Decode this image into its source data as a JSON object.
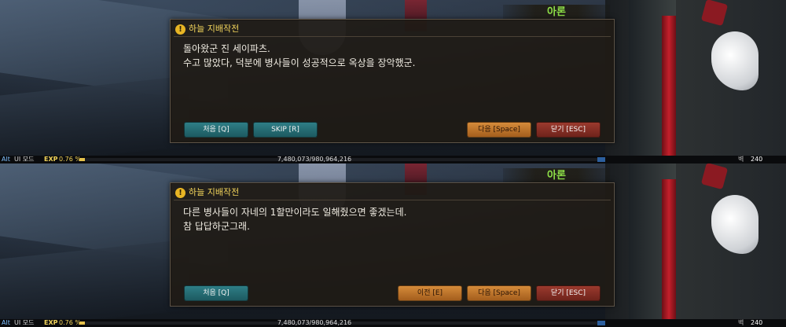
{
  "panels": [
    {
      "npc_name": "아론",
      "dialog": {
        "title": "하늘 지배작전",
        "lines": [
          "돌아왔군 진 세이파츠.",
          "수고 많았다, 덕분에 병사들이 성공적으로 옥상을 장악했군."
        ]
      },
      "buttons": {
        "first": "처음 [Q]",
        "skip": "SKIP [R]",
        "next": "다음 [Space]",
        "close": "닫기 [ESC]"
      }
    },
    {
      "npc_name": "아론",
      "dialog": {
        "title": "하늘 지배작전",
        "lines": [
          "다른 병사들이 자네의 1할만이라도 일해줬으면 좋겠는데.",
          "참 답답하군그래."
        ]
      },
      "buttons": {
        "first": "처음 [Q]",
        "prev": "이전 [E]",
        "next": "다음 [Space]",
        "close": "닫기 [ESC]"
      }
    }
  ],
  "statusbar": {
    "alt_label": "Alt",
    "ui_label": "UI 모드",
    "exp_label": "EXP",
    "exp_percent": "0.76 %",
    "exp_fraction": 0.0076,
    "exp_value": "7,480,073/980,964,216",
    "right_label": "벽",
    "right_value": "240"
  },
  "colors": {
    "accent_title": "#f1d35b",
    "npc_name": "#8ee048",
    "button_teal": "#1d5a61",
    "button_orange": "#d58b3a",
    "button_red": "#6f231b"
  }
}
